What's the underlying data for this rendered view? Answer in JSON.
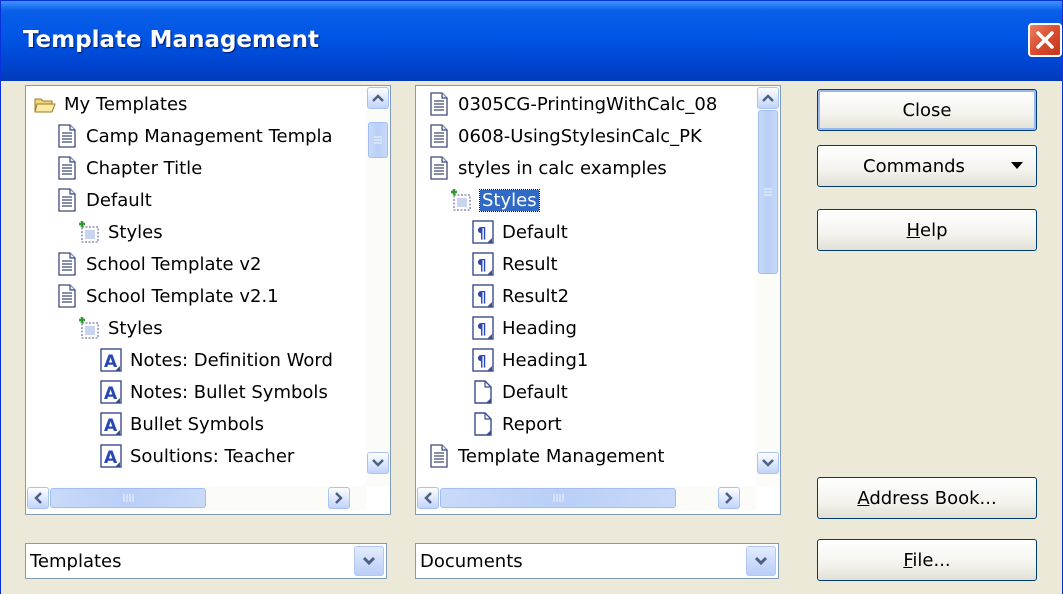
{
  "window": {
    "title": "Template Management",
    "close_icon": "close-icon"
  },
  "left_tree": {
    "items": [
      {
        "label": "My Templates",
        "icon": "folder-open-icon",
        "level": 0,
        "selected": false
      },
      {
        "label": "Camp Management Templa",
        "icon": "document-icon",
        "level": 1,
        "selected": false
      },
      {
        "label": "Chapter Title",
        "icon": "document-icon",
        "level": 1,
        "selected": false
      },
      {
        "label": "Default",
        "icon": "document-icon",
        "level": 1,
        "selected": false
      },
      {
        "label": "Styles",
        "icon": "styles-folder-icon",
        "level": 2,
        "selected": false
      },
      {
        "label": "School Template v2",
        "icon": "document-icon",
        "level": 1,
        "selected": false
      },
      {
        "label": "School Template v2.1",
        "icon": "document-icon",
        "level": 1,
        "selected": false
      },
      {
        "label": "Styles",
        "icon": "styles-folder-icon",
        "level": 2,
        "selected": false
      },
      {
        "label": "Notes: Definition Word",
        "icon": "character-style-icon",
        "level": 3,
        "selected": false
      },
      {
        "label": "Notes: Bullet Symbols",
        "icon": "character-style-icon",
        "level": 3,
        "selected": false
      },
      {
        "label": "Bullet Symbols",
        "icon": "character-style-icon",
        "level": 3,
        "selected": false
      },
      {
        "label": "Soultions: Teacher",
        "icon": "character-style-icon",
        "level": 3,
        "selected": false
      }
    ]
  },
  "right_tree": {
    "items": [
      {
        "label": "0305CG-PrintingWithCalc_08",
        "icon": "document-icon",
        "level": 0,
        "selected": false
      },
      {
        "label": "0608-UsingStylesinCalc_PK",
        "icon": "document-icon",
        "level": 0,
        "selected": false
      },
      {
        "label": "styles in calc examples",
        "icon": "document-icon",
        "level": 0,
        "selected": false
      },
      {
        "label": "Styles",
        "icon": "styles-folder-icon",
        "level": 1,
        "selected": true
      },
      {
        "label": "Default",
        "icon": "paragraph-style-icon",
        "level": 2,
        "selected": false
      },
      {
        "label": "Result",
        "icon": "paragraph-style-icon",
        "level": 2,
        "selected": false
      },
      {
        "label": "Result2",
        "icon": "paragraph-style-icon",
        "level": 2,
        "selected": false
      },
      {
        "label": "Heading",
        "icon": "paragraph-style-icon",
        "level": 2,
        "selected": false
      },
      {
        "label": "Heading1",
        "icon": "paragraph-style-icon",
        "level": 2,
        "selected": false
      },
      {
        "label": "Default",
        "icon": "page-style-icon",
        "level": 2,
        "selected": false
      },
      {
        "label": "Report",
        "icon": "page-style-icon",
        "level": 2,
        "selected": false
      },
      {
        "label": "Template Management",
        "icon": "document-icon",
        "level": 0,
        "selected": false
      }
    ]
  },
  "left_combo": {
    "value": "Templates"
  },
  "right_combo": {
    "value": "Documents"
  },
  "buttons": {
    "close": "Close",
    "commands": "Commands",
    "help_pre": "",
    "help_u": "H",
    "help_post": "elp",
    "address_pre": "",
    "address_u": "A",
    "address_post": "ddress Book...",
    "file_pre": "",
    "file_u": "F",
    "file_post": "ile..."
  }
}
